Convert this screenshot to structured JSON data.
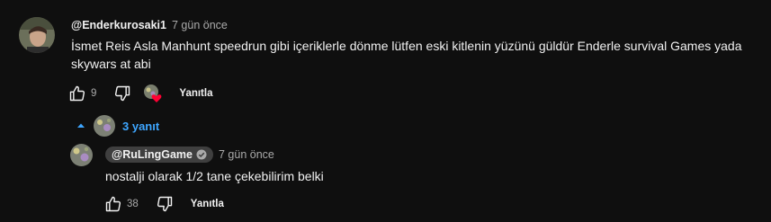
{
  "comment": {
    "author": "@Enderkurosaki1",
    "time": "7 gün önce",
    "text_line1": "İsmet Reis Asla Manhunt speedrun gibi içeriklerle dönme  lütfen eski kitlenin yüzünü güldür Enderle survival Games yada",
    "text_line2": "skywars at abi",
    "like_count": "9",
    "reply_label": "Yanıtla"
  },
  "replies_toggle": {
    "label": "3 yanıt"
  },
  "reply": {
    "author": "@RuLingGame",
    "time": "7 gün önce",
    "text": "nostalji olarak 1/2 tane çekebilirim belki",
    "like_count": "38",
    "reply_label": "Yanıtla"
  },
  "colors": {
    "background": "#0f0f0f",
    "link_blue": "#3ea6ff",
    "heart_red": "#ff0033"
  }
}
